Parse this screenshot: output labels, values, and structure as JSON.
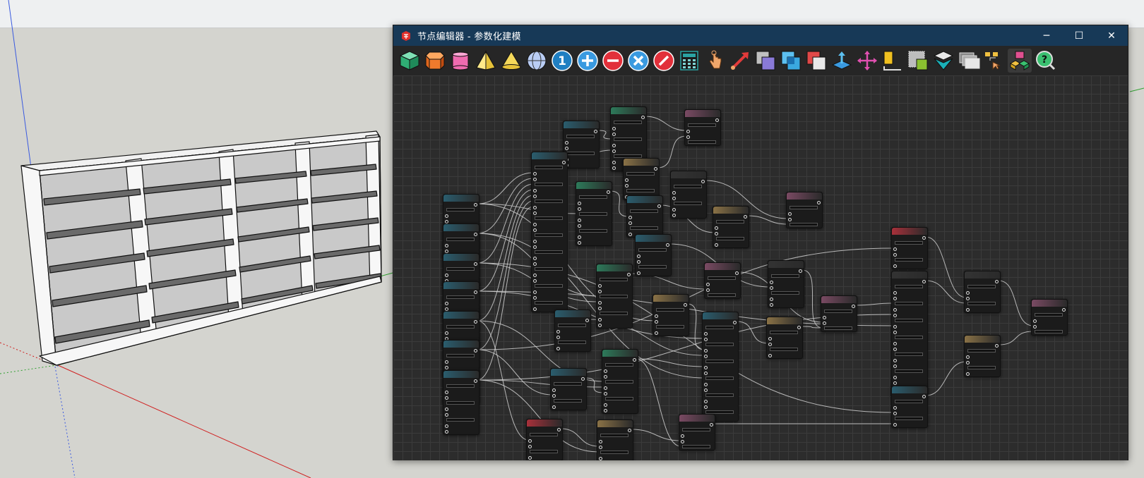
{
  "window": {
    "title": "节点编辑器 - 参数化建模",
    "minimize": "─",
    "maximize": "☐",
    "close": "✕"
  },
  "toolbar": {
    "items": [
      {
        "name": "cube-icon",
        "color": "#3cc28a"
      },
      {
        "name": "hexagonal-prism-icon",
        "color": "#f07a2c"
      },
      {
        "name": "cylinder-icon",
        "color": "#ef6bb0"
      },
      {
        "name": "pyramid-icon",
        "color": "#f4d85a"
      },
      {
        "name": "cone-icon",
        "color": "#f4d85a"
      },
      {
        "name": "sphere-icon",
        "color": "#9fb6e8"
      },
      {
        "name": "number-one-icon",
        "label": "1",
        "color": "#1f7fc2"
      },
      {
        "name": "add-icon",
        "color": "#3a9ae0"
      },
      {
        "name": "subtract-icon",
        "color": "#e2303a"
      },
      {
        "name": "multiply-icon",
        "color": "#3a9ae0"
      },
      {
        "name": "divide-icon",
        "color": "#e2303a"
      },
      {
        "name": "calculator-icon",
        "color": "#2aa3a3"
      },
      {
        "name": "pointer-hand-icon",
        "color": "#f0a66a"
      },
      {
        "name": "arrow-line-icon",
        "color": "#e23a3a"
      },
      {
        "name": "union-icon",
        "color": "#8a7ad8"
      },
      {
        "name": "intersect-icon",
        "color": "#3aa8e0"
      },
      {
        "name": "difference-icon",
        "color": "#e04848"
      },
      {
        "name": "move-up-icon",
        "color": "#3a9ae0"
      },
      {
        "name": "move-icon",
        "color": "#e050b0"
      },
      {
        "name": "align-icon",
        "color": "#f0c020"
      },
      {
        "name": "offset-icon",
        "color": "#8ac030"
      },
      {
        "name": "mirror-icon",
        "color": "#1ab0b8"
      },
      {
        "name": "layers-icon",
        "color": "#d8d8d8"
      },
      {
        "name": "group-icon",
        "color": "#f0c040"
      },
      {
        "name": "components-icon",
        "color": "#e05090"
      },
      {
        "name": "help-icon",
        "color": "#3ac070"
      }
    ]
  },
  "colors": {
    "canvas": "#2c2c2c",
    "grid": "#3b3b3b",
    "titlebar": "#173957",
    "wire": "#cfcfcf"
  }
}
